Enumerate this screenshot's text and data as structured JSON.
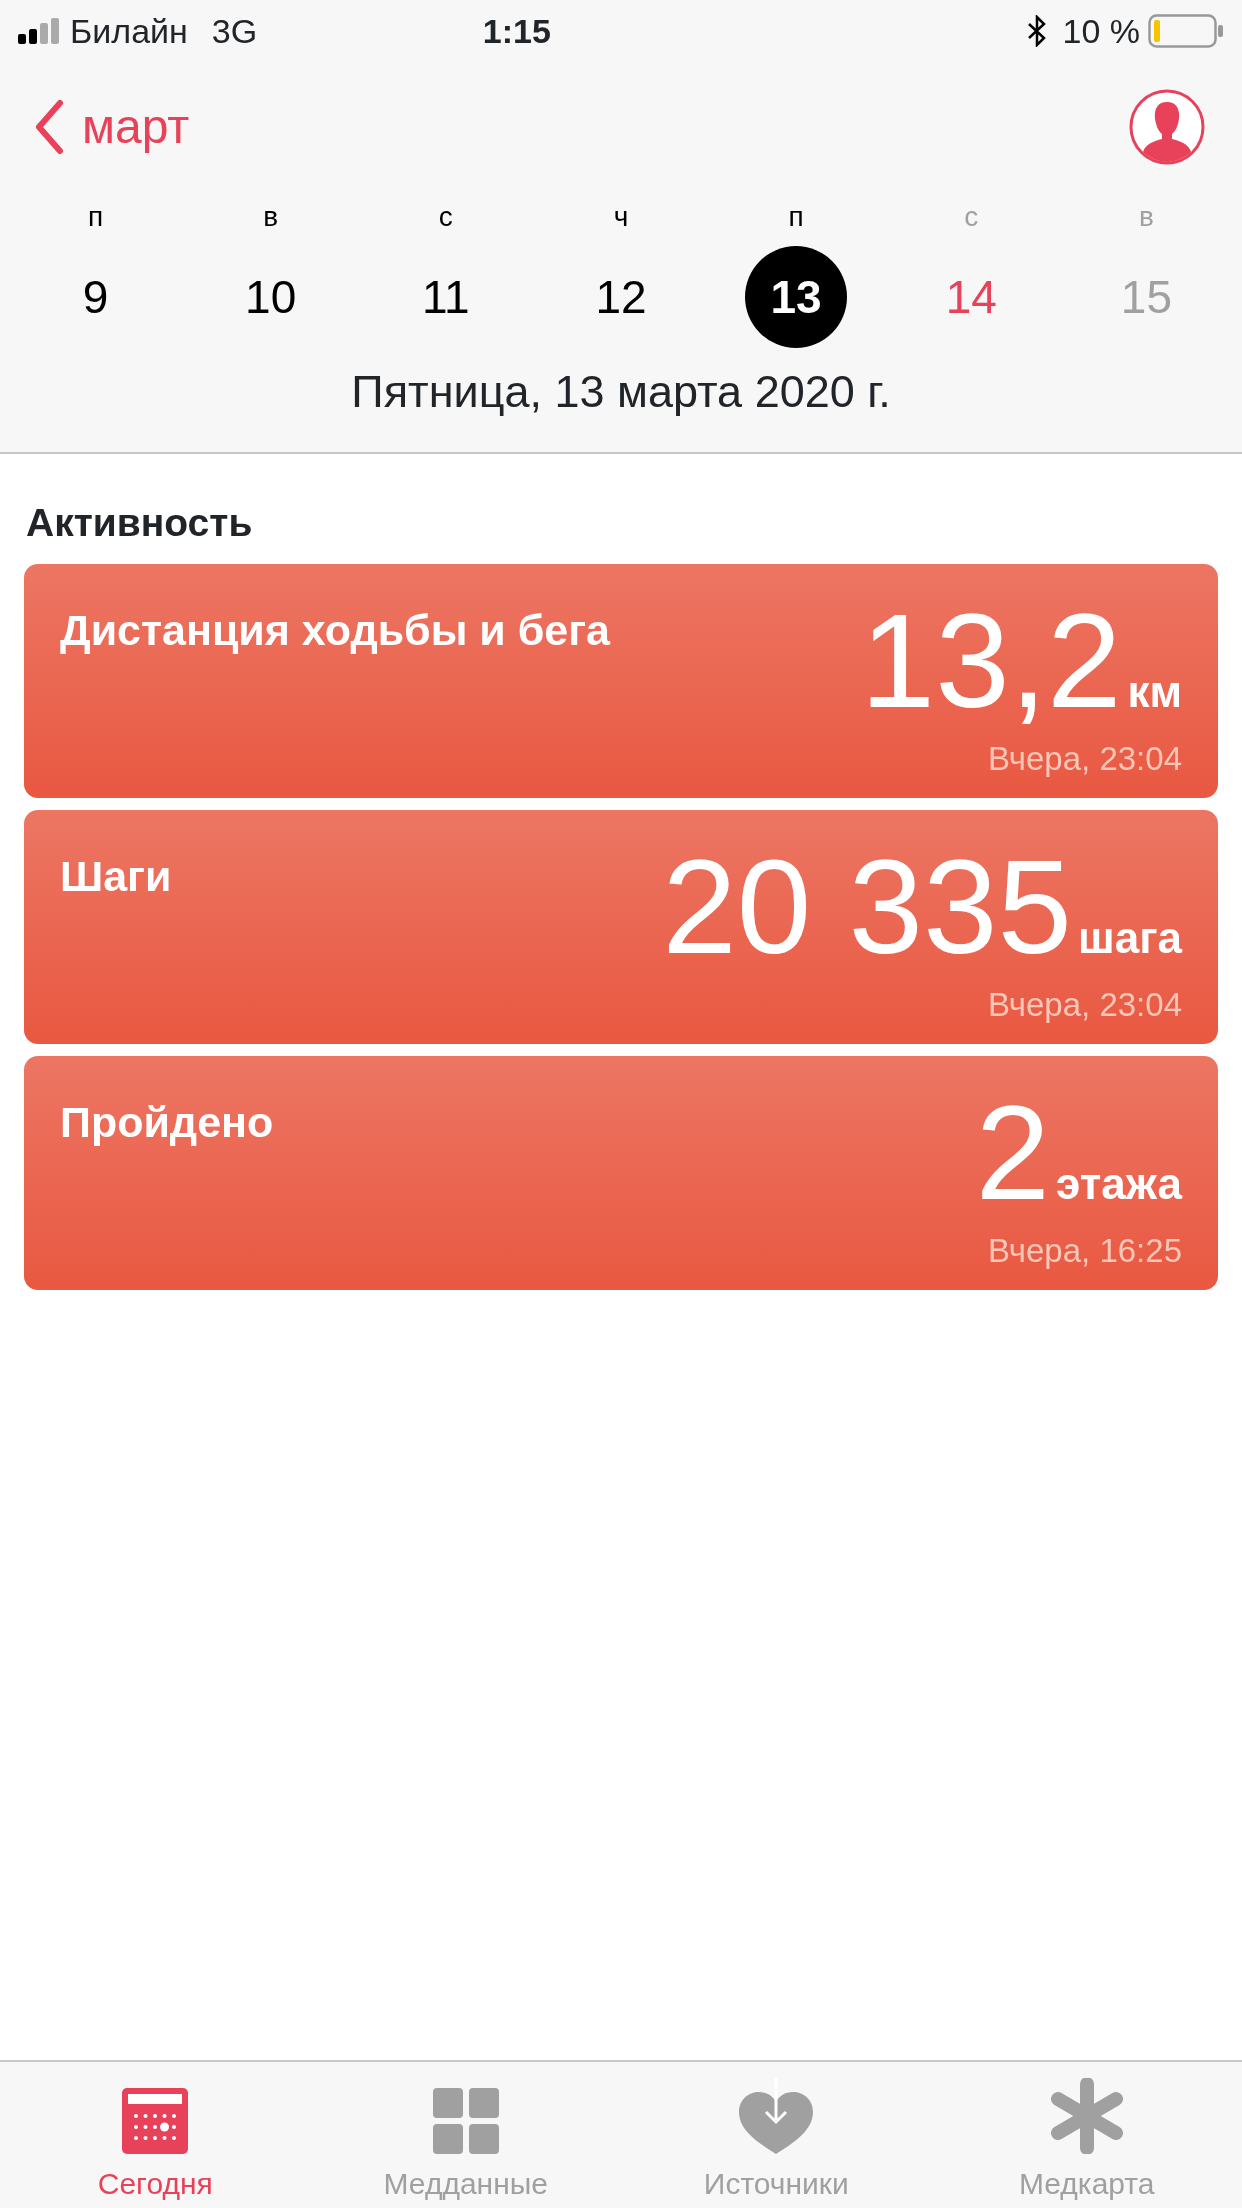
{
  "status_bar": {
    "carrier": "Билайн",
    "network": "3G",
    "time": "1:15",
    "battery": "10 %"
  },
  "nav": {
    "back": "март"
  },
  "week": [
    {
      "weekday": "п",
      "day": "9",
      "selected": false,
      "today": false,
      "future": false
    },
    {
      "weekday": "в",
      "day": "10",
      "selected": false,
      "today": false,
      "future": false
    },
    {
      "weekday": "с",
      "day": "11",
      "selected": false,
      "today": false,
      "future": false
    },
    {
      "weekday": "ч",
      "day": "12",
      "selected": false,
      "today": false,
      "future": false
    },
    {
      "weekday": "п",
      "day": "13",
      "selected": true,
      "today": false,
      "future": false
    },
    {
      "weekday": "с",
      "day": "14",
      "selected": false,
      "today": true,
      "future": true
    },
    {
      "weekday": "в",
      "day": "15",
      "selected": false,
      "today": false,
      "future": true
    }
  ],
  "date_line": "Пятница, 13 марта 2020 г.",
  "section_title": "Активность",
  "cards": [
    {
      "title": "Дистанция ходьбы и бега",
      "value": "13,2",
      "unit": "км",
      "time": "Вчера, 23:04"
    },
    {
      "title": "Шаги",
      "value": "20 335",
      "unit": "шага",
      "time": "Вчера, 23:04"
    },
    {
      "title": "Пройдено",
      "value": "2",
      "unit": "этажа",
      "time": "Вчера, 16:25"
    }
  ],
  "tabs": [
    {
      "label": "Сегодня",
      "kind": "today",
      "selected": true
    },
    {
      "label": "Медданные",
      "kind": "data",
      "selected": false
    },
    {
      "label": "Источники",
      "kind": "sources",
      "selected": false
    },
    {
      "label": "Медкарта",
      "kind": "card",
      "selected": false
    }
  ]
}
